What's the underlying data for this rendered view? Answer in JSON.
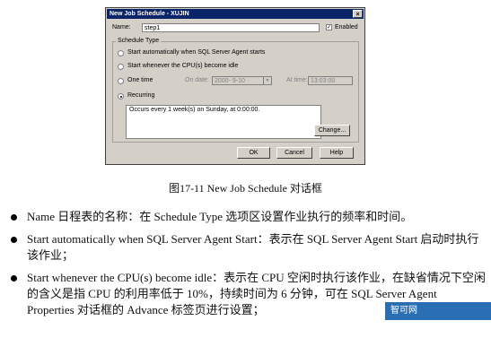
{
  "dialog": {
    "title": "New Job Schedule - XUJIN",
    "close_glyph": "×",
    "name_label": "Name:",
    "name_value": "step1",
    "enabled_label": "Enabled",
    "enabled_checked": true,
    "group_label": "Schedule Type",
    "options": [
      {
        "label": "Start automatically when SQL Server Agent starts",
        "selected": false
      },
      {
        "label": "Start whenever the CPU(s) become idle",
        "selected": false
      },
      {
        "label": "One time",
        "selected": false
      },
      {
        "label": "Recurring",
        "selected": true
      }
    ],
    "on_date_label": "On date:",
    "on_date_value": "2000- 9-10",
    "at_time_label": "At time:",
    "at_time_value": "13:03:00",
    "recurring_desc": "Occurs every 1 week(s) on Sunday, at 0:00:00.",
    "change_button": "Change...",
    "ok_button": "OK",
    "cancel_button": "Cancel",
    "help_button": "Help"
  },
  "caption": "图17-11  New Job Schedule 对话框",
  "bullets": [
    "Name 日程表的名称：在 Schedule Type 选项区设置作业执行的频率和时间。",
    "Start automatically when SQL Server Agent Start：表示在 SQL Server Agent Start 启动时执行该作业；",
    "Start whenever the CPU(s) become idle：表示在 CPU 空闲时执行该作业，在缺省情况下空闲的含义是指 CPU 的利用率低于 10%，持续时间为 6 分钟，可在 SQL Server Agent Properties 对话框的 Advance 标签页进行设置；"
  ],
  "watermark": "智可网 www.hzhike.com"
}
